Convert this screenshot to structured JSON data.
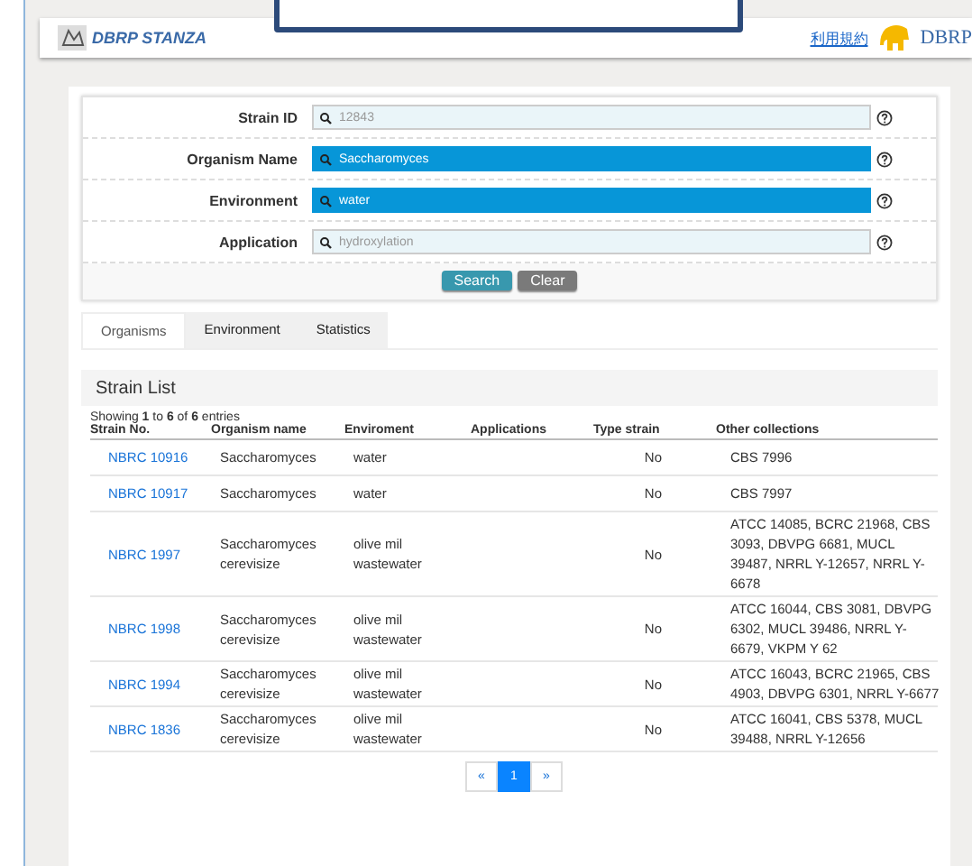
{
  "header": {
    "logo_text": "DBRP STANZA",
    "terms_link": "利用規約",
    "brand_text": "DBRP"
  },
  "search_form": {
    "fields": [
      {
        "label": "Strain ID",
        "placeholder": "12843",
        "highlighted": false
      },
      {
        "label": "Organism Name",
        "value": "Saccharomyces",
        "highlighted": true
      },
      {
        "label": "Environment",
        "value": "water",
        "highlighted": true
      },
      {
        "label": "Application",
        "placeholder": "hydroxylation",
        "highlighted": false
      }
    ],
    "buttons": [
      {
        "label": "Search",
        "kind": "primary"
      },
      {
        "label": "Clear",
        "kind": "secondary"
      }
    ]
  },
  "tabs": [
    {
      "label": "Organisms",
      "selected": true
    },
    {
      "label": "Environment",
      "selected": false
    },
    {
      "label": "Statistics",
      "selected": false
    }
  ],
  "strain_list": {
    "title": "Strain List",
    "info": "Showing **1** to **6** of **6** entries",
    "columns": [
      "Strain No.",
      "Organism name",
      "Enviroment",
      "Applications",
      "Type strain",
      "Other collections"
    ],
    "rows": [
      {
        "strain_no": "NBRC 10916",
        "organism": "Saccharomyces",
        "environment": "water",
        "applications": "",
        "type_strain": "No",
        "other": "CBS 7996"
      },
      {
        "strain_no": "NBRC 10917",
        "organism": "Saccharomyces",
        "environment": "water",
        "applications": "",
        "type_strain": "No",
        "other": "CBS 7997"
      },
      {
        "strain_no": "NBRC 1997",
        "organism": "Saccharomyces cerevisize",
        "environment": "olive mil wastewater",
        "applications": "",
        "type_strain": "No",
        "other": "ATCC 14085, BCRC 21968, CBS 3093, DBVPG 6681, MUCL 39487, NRRL Y-12657, NRRL Y-6678"
      },
      {
        "strain_no": "NBRC 1998",
        "organism": "Saccharomyces cerevisize",
        "environment": "olive mil wastewater",
        "applications": "",
        "type_strain": "No",
        "other": "ATCC 16044, CBS 3081, DBVPG 6302, MUCL 39486, NRRL Y-6679, VKPM Y 62"
      },
      {
        "strain_no": "NBRC 1994",
        "organism": "Saccharomyces cerevisize",
        "environment": "olive mil wastewater",
        "applications": "",
        "type_strain": "No",
        "other": "ATCC 16043, BCRC 21965, CBS 4903, DBVPG 6301, NRRL Y-6677"
      },
      {
        "strain_no": "NBRC 1836",
        "organism": "Saccharomyces cerevisize",
        "environment": "olive mil wastewater",
        "applications": "",
        "type_strain": "No",
        "other": "ATCC 16041, CBS 5378, MUCL 39488, NRRL Y-12656"
      }
    ]
  },
  "pagination": [
    {
      "label": "«",
      "selected": false
    },
    {
      "label": "1",
      "selected": true
    },
    {
      "label": "»",
      "selected": false
    }
  ]
}
